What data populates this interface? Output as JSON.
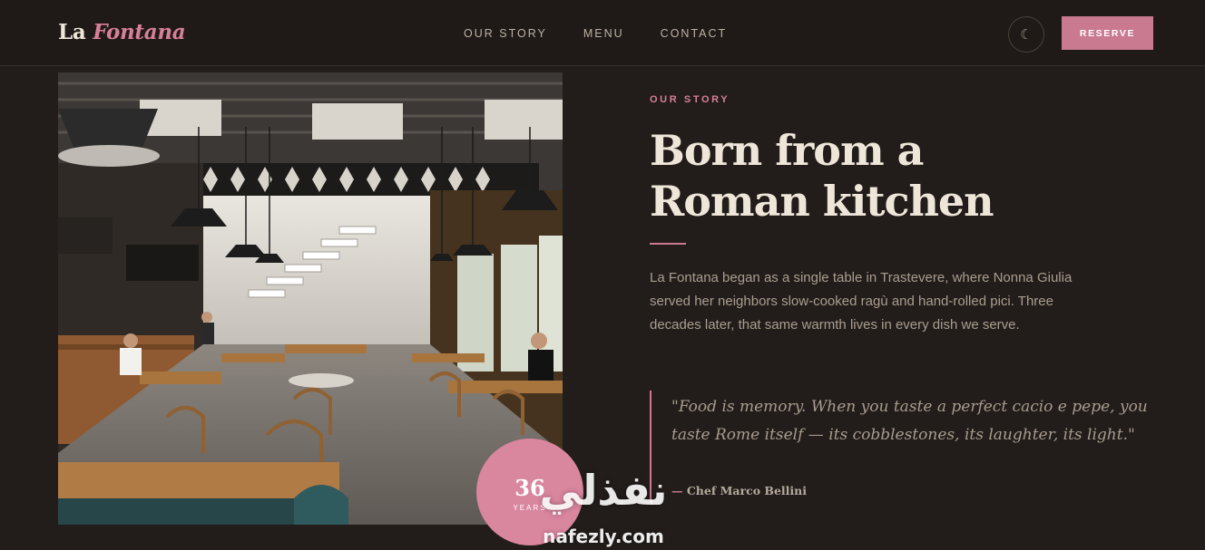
{
  "header": {
    "logo": {
      "main": "La",
      "accent": "Fontana"
    },
    "nav": [
      "OUR STORY",
      "MENU",
      "CONTACT"
    ],
    "theme_toggle_icon": "moon-icon",
    "reserve_label": "RESERVE"
  },
  "story": {
    "eyebrow": "OUR STORY",
    "title_line1": "Born from a",
    "title_line2": "Roman kitchen",
    "body": "La Fontana began as a single table in Trastevere, where Nonna Giulia served her neighbors slow-cooked ragù and hand-rolled pici. Three decades later, that same warmth lives in every dish we serve.",
    "quote": "\"Food is memory. When you taste a perfect cacio e pepe, you taste Rome itself — its cobblestones, its laughter, its light.\"",
    "quote_author": "Chef Marco Bellini"
  },
  "badge": {
    "number": "36",
    "unit": "YEARS"
  },
  "watermark": {
    "arabic": "نفذلي",
    "latin": "nafezly.com"
  },
  "colors": {
    "accent": "#c97a91",
    "background": "#221d1a",
    "text": "#efe6da"
  }
}
